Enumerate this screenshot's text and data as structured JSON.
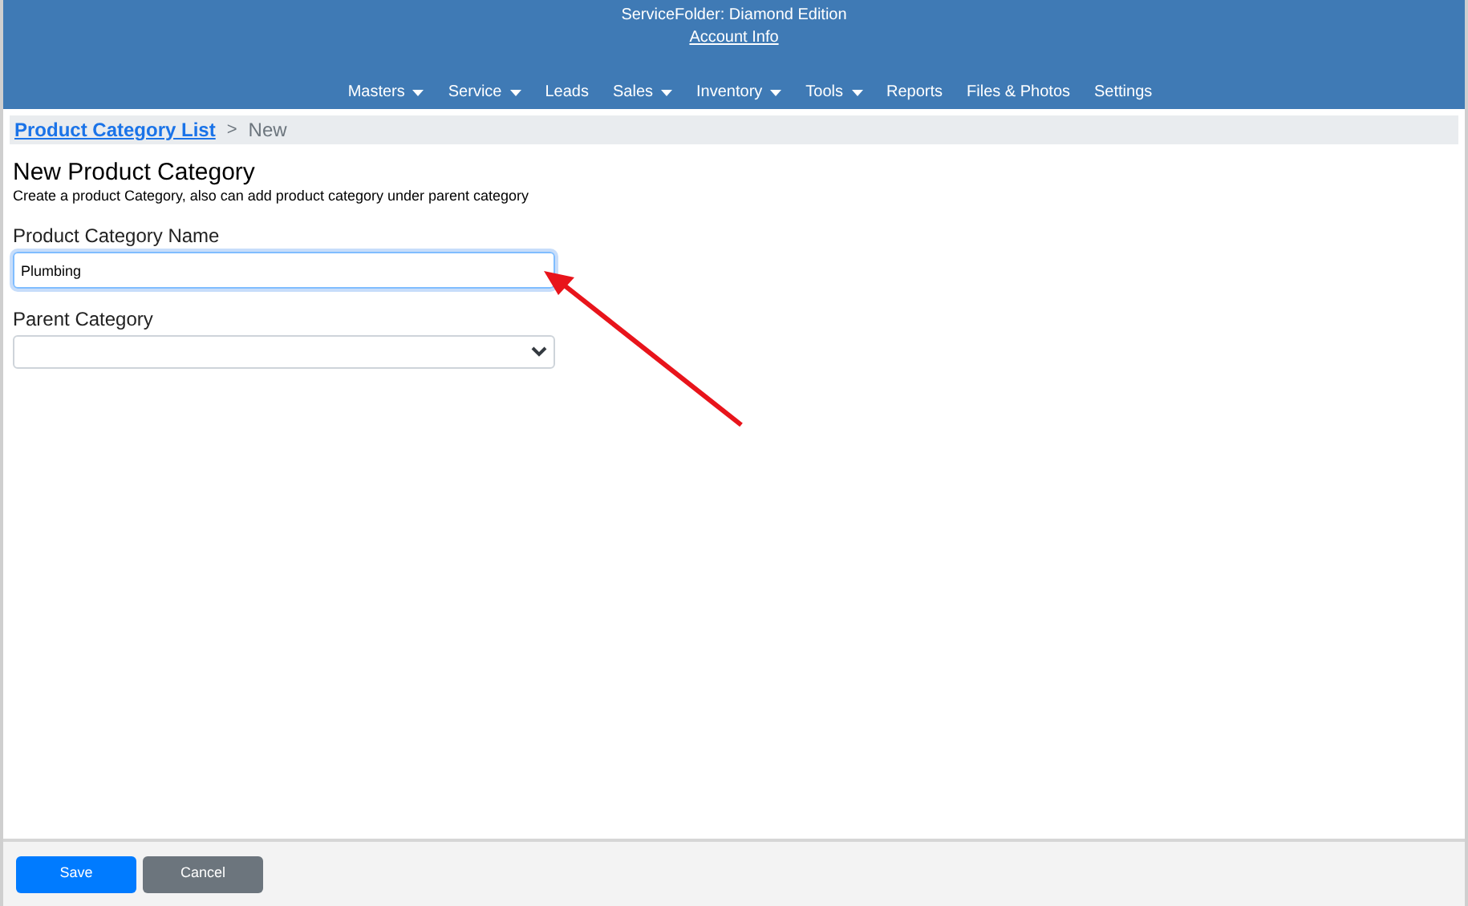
{
  "header": {
    "title": "ServiceFolder: Diamond Edition",
    "account_link": "Account Info"
  },
  "nav": [
    {
      "label": "Masters",
      "has_menu": true
    },
    {
      "label": "Service",
      "has_menu": true
    },
    {
      "label": "Leads",
      "has_menu": false
    },
    {
      "label": "Sales",
      "has_menu": true
    },
    {
      "label": "Inventory",
      "has_menu": true
    },
    {
      "label": "Tools",
      "has_menu": true
    },
    {
      "label": "Reports",
      "has_menu": false
    },
    {
      "label": "Files & Photos",
      "has_menu": false
    },
    {
      "label": "Settings",
      "has_menu": false
    }
  ],
  "breadcrumb": {
    "link": "Product Category List",
    "separator": ">",
    "current": "New"
  },
  "page": {
    "title": "New Product Category",
    "description": "Create a product Category, also can add product category under parent category"
  },
  "fields": [
    {
      "kind": "text",
      "label": "Product Category Name",
      "value": "Plumbing",
      "focused": true
    },
    {
      "kind": "select",
      "label": "Parent Category",
      "focused": false
    }
  ],
  "buttons": [
    {
      "label": "Save",
      "kind": "primary"
    },
    {
      "label": "Cancel",
      "kind": "secondary"
    }
  ]
}
